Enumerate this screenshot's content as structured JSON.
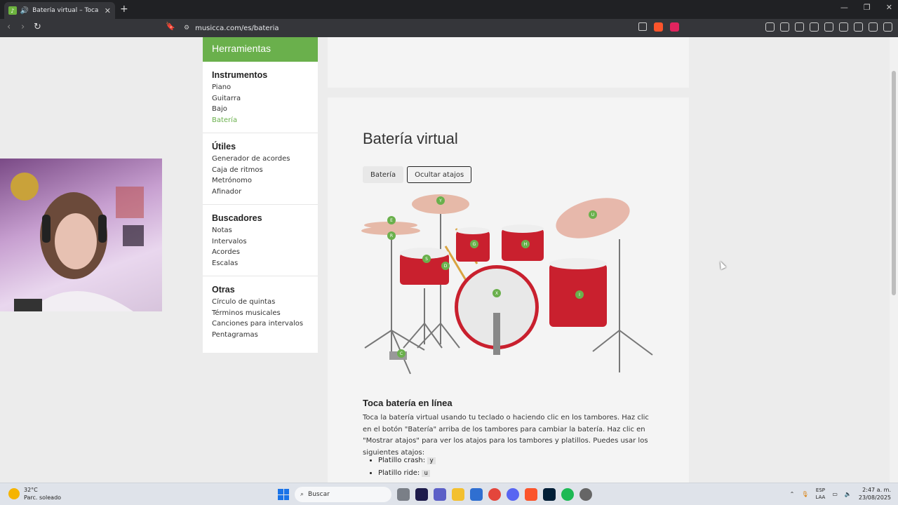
{
  "browser": {
    "tab_title": "Batería virtual – Toca la batería",
    "url": "musicca.com/es/bateria"
  },
  "sidebar": {
    "header": "Herramientas",
    "groups": [
      {
        "title": "Instrumentos",
        "items": [
          "Piano",
          "Guitarra",
          "Bajo",
          "Batería"
        ]
      },
      {
        "title": "Útiles",
        "items": [
          "Generador de acordes",
          "Caja de ritmos",
          "Metrónomo",
          "Afinador"
        ]
      },
      {
        "title": "Buscadores",
        "items": [
          "Notas",
          "Intervalos",
          "Acordes",
          "Escalas"
        ]
      },
      {
        "title": "Otras",
        "items": [
          "Círculo de quintas",
          "Términos musicales",
          "Canciones para intervalos",
          "Pentagramas"
        ]
      }
    ]
  },
  "main": {
    "title": "Batería virtual",
    "buttons": {
      "drums": "Batería",
      "shortcuts": "Ocultar atajos"
    },
    "drum_keys": {
      "crash_left": "E",
      "hihat": "R",
      "crash_top": "Y",
      "ride": "U",
      "snare": "S",
      "pedal_hh": "D",
      "tom1": "G",
      "tom2": "H",
      "bass": "X",
      "floor_tom": "I",
      "hh_pedal": "C"
    },
    "section_title": "Toca batería en línea",
    "description": "Toca la batería virtual usando tu teclado o haciendo clic en los tambores. Haz clic en el botón \"Batería\" arriba de los tambores para cambiar la batería. Haz clic en \"Mostrar atajos\" para ver los atajos para los tambores y platillos. Puedes usar los siguientes atajos:",
    "shortcuts": [
      {
        "label": "Platillo crash:",
        "key": "y"
      },
      {
        "label": "Platillo ride:",
        "key": "u"
      }
    ]
  },
  "taskbar": {
    "temp": "32°C",
    "weather": "Parc. soleado",
    "search": "Buscar",
    "lang1": "ESP",
    "lang2": "LAA",
    "time": "2:47 a. m.",
    "date": "23/08/2025"
  }
}
